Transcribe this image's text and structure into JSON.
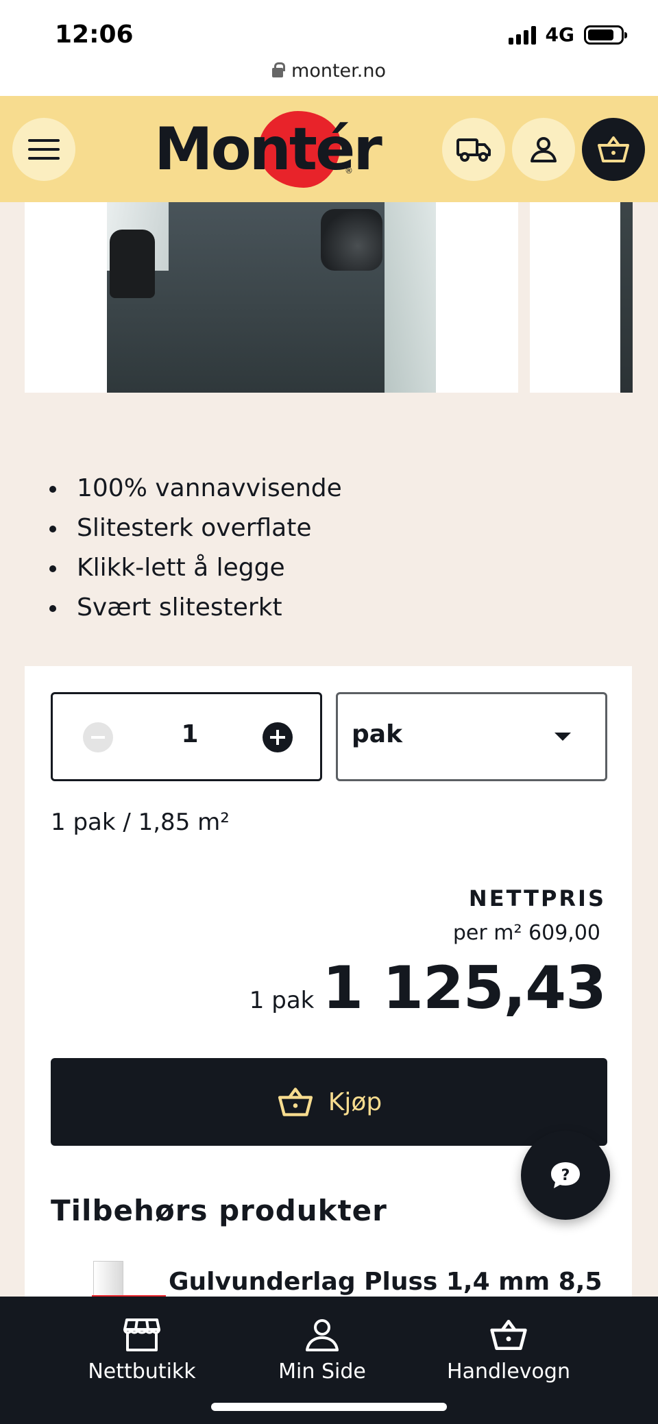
{
  "status_bar": {
    "time": "12:06",
    "network": "4G",
    "url": "monter.no"
  },
  "header": {
    "logo_text": "Montér",
    "logo_registered": "®",
    "icons": [
      "menu-icon",
      "truck-icon",
      "user-icon",
      "basket-icon"
    ],
    "colors": {
      "header_bg": "#f7dc8f",
      "logo_blob": "#e8232a",
      "dark": "#14181f"
    }
  },
  "product": {
    "features": [
      "100% vannavvisende",
      "Slitesterk overflate",
      "Klikk-lett å legge",
      "Svært slitesterkt"
    ]
  },
  "purchase": {
    "quantity": "1",
    "unit": "pak",
    "pack_info": "1 pak / 1,85 m²",
    "price_label": "NETTPRIS",
    "price_per_unit": "per m² 609,00",
    "price_pack_label": "1 pak",
    "price_total": "1 125,43",
    "buy_label": "Kjøp"
  },
  "accessories": {
    "title": "Tilbehørs produkter",
    "items": [
      {
        "name": "Gulvunderlag Pluss 1,4 mm 8,5"
      }
    ]
  },
  "bottom_nav": {
    "items": [
      {
        "label": "Nettbutikk",
        "icon": "store-icon"
      },
      {
        "label": "Min Side",
        "icon": "user-icon"
      },
      {
        "label": "Handlevogn",
        "icon": "basket-icon"
      }
    ]
  }
}
